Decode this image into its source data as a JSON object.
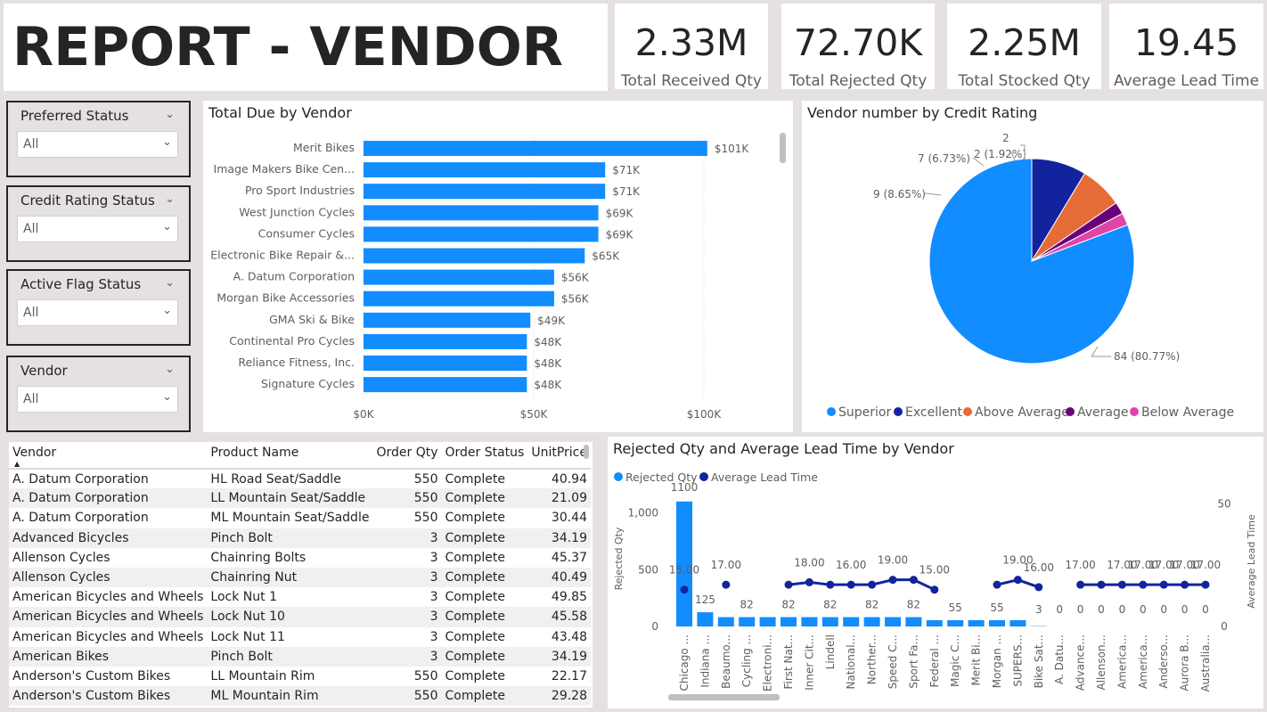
{
  "report_title": "REPORT - VENDOR",
  "kpis": [
    {
      "value": "2.33M",
      "label": "Total Received Qty"
    },
    {
      "value": "72.70K",
      "label": "Total Rejected Qty"
    },
    {
      "value": "2.25M",
      "label": "Total Stocked Qty"
    },
    {
      "value": "19.45",
      "label": "Average Lead Time"
    }
  ],
  "slicers": [
    {
      "title": "Preferred Status",
      "value": "All"
    },
    {
      "title": "Credit Rating Status",
      "value": "All"
    },
    {
      "title": "Active Flag Status",
      "value": "All"
    },
    {
      "title": "Vendor",
      "value": "All"
    }
  ],
  "colors": {
    "blue": "#118dff",
    "navy": "#12239e",
    "orange": "#e66c37",
    "purple": "#6b007b",
    "pink": "#e044a7"
  },
  "chart_data": [
    {
      "type": "bar",
      "orientation": "horizontal",
      "title": "Total Due by Vendor",
      "categories": [
        "Merit Bikes",
        "Image Makers Bike Cen...",
        "Pro Sport Industries",
        "West Junction Cycles",
        "Consumer Cycles",
        "Electronic Bike Repair &...",
        "A. Datum Corporation",
        "Morgan Bike Accessories",
        "GMA Ski & Bike",
        "Continental Pro Cycles",
        "Reliance Fitness, Inc.",
        "Signature Cycles"
      ],
      "values": [
        101,
        71,
        71,
        69,
        69,
        65,
        56,
        56,
        49,
        48,
        48,
        48
      ],
      "data_labels": [
        "$101K",
        "$71K",
        "$71K",
        "$69K",
        "$69K",
        "$65K",
        "$56K",
        "$56K",
        "$49K",
        "$48K",
        "$48K",
        "$48K"
      ],
      "xticks": [
        "$0K",
        "$50K",
        "$100K"
      ],
      "xlim": [
        0,
        100
      ]
    },
    {
      "type": "pie",
      "title": "Vendor number by Credit Rating",
      "slices": [
        {
          "name": "Superior",
          "value": 84,
          "label": "84 (80.77%)"
        },
        {
          "name": "Excellent",
          "value": 9,
          "label": "9 (8.65%)"
        },
        {
          "name": "Above Average",
          "value": 7,
          "label": "7 (6.73%)"
        },
        {
          "name": "Average",
          "value": 2,
          "label": "2 (1.92%)"
        },
        {
          "name": "Below Average",
          "value": 2,
          "label": "2"
        }
      ],
      "legend": "bottom"
    },
    {
      "type": "bar",
      "title": "Rejected Qty and Average Lead Time by Vendor",
      "legend_items": [
        "Rejected Qty",
        "Average Lead Time"
      ],
      "y_label": "Rejected Qty",
      "y2_label": "Average Lead Time",
      "yticks": [
        "0",
        "500",
        "1,000"
      ],
      "y2ticks": [
        "0",
        "50"
      ],
      "ylim": [
        0,
        1200
      ],
      "y2lim": [
        0,
        55
      ],
      "categories": [
        "Chicago ...",
        "Indiana ...",
        "Beaumo...",
        "Cycling ...",
        "Electroni...",
        "First Nat...",
        "Inner Cit...",
        "Lindell",
        "National...",
        "Norther...",
        "Speed C...",
        "Sport Fa...",
        "Federal ...",
        "Magic C...",
        "Merit Bi...",
        "Morgan ...",
        "SUPERS...",
        "Bike Sat...",
        "A. Datu...",
        "Advance...",
        "Allenson...",
        "America...",
        "America...",
        "Anderso...",
        "Aurora B...",
        "Australia..."
      ],
      "series": [
        {
          "name": "Rejected Qty",
          "values": [
            1100,
            125,
            82,
            82,
            82,
            82,
            82,
            82,
            82,
            82,
            82,
            82,
            55,
            55,
            55,
            55,
            55,
            3,
            0,
            0,
            0,
            0,
            0,
            0,
            0,
            0
          ]
        },
        {
          "name": "Average Lead Time",
          "values": [
            15,
            null,
            17,
            null,
            null,
            17,
            18,
            17,
            17,
            17,
            19,
            19,
            15,
            null,
            null,
            17,
            19,
            16,
            null,
            17,
            17,
            17,
            17,
            17,
            17,
            17
          ]
        }
      ],
      "bar_labels": [
        "1100",
        "125",
        "",
        "82",
        "",
        "82",
        "",
        "82",
        "",
        "82",
        "",
        "82",
        "",
        "55",
        "",
        "55",
        "",
        "3",
        "0",
        "0",
        "0",
        "0",
        "0",
        "0",
        "0",
        "0"
      ],
      "line_labels": [
        "15.00",
        "",
        "17.00",
        "",
        "",
        "",
        "18.00",
        "",
        "16.00",
        "",
        "19.00",
        "",
        "15.00",
        "",
        "",
        "",
        "19.00",
        "16.00",
        "",
        "17.00",
        "",
        "17.00",
        "17.00",
        "17.00",
        "17.00",
        "17.00"
      ]
    }
  ],
  "table": {
    "columns": [
      "Vendor",
      "Product Name",
      "Order Qty",
      "Order Status",
      "UnitPrice"
    ],
    "rows": [
      [
        "A. Datum Corporation",
        "HL Road Seat/Saddle",
        "550",
        "Complete",
        "40.94"
      ],
      [
        "A. Datum Corporation",
        "LL Mountain Seat/Saddle",
        "550",
        "Complete",
        "21.09"
      ],
      [
        "A. Datum Corporation",
        "ML Mountain Seat/Saddle",
        "550",
        "Complete",
        "30.44"
      ],
      [
        "Advanced Bicycles",
        "Pinch Bolt",
        "3",
        "Complete",
        "34.19"
      ],
      [
        "Allenson Cycles",
        "Chainring Bolts",
        "3",
        "Complete",
        "45.37"
      ],
      [
        "Allenson Cycles",
        "Chainring Nut",
        "3",
        "Complete",
        "40.49"
      ],
      [
        "American Bicycles and Wheels",
        "Lock Nut 1",
        "3",
        "Complete",
        "49.85"
      ],
      [
        "American Bicycles and Wheels",
        "Lock Nut 10",
        "3",
        "Complete",
        "45.58"
      ],
      [
        "American Bicycles and Wheels",
        "Lock Nut 11",
        "3",
        "Complete",
        "43.48"
      ],
      [
        "American Bikes",
        "Pinch Bolt",
        "3",
        "Complete",
        "34.19"
      ],
      [
        "Anderson's Custom Bikes",
        "LL Mountain Rim",
        "550",
        "Complete",
        "22.17"
      ],
      [
        "Anderson's Custom Bikes",
        "ML Mountain Rim",
        "550",
        "Complete",
        "29.28"
      ]
    ]
  }
}
